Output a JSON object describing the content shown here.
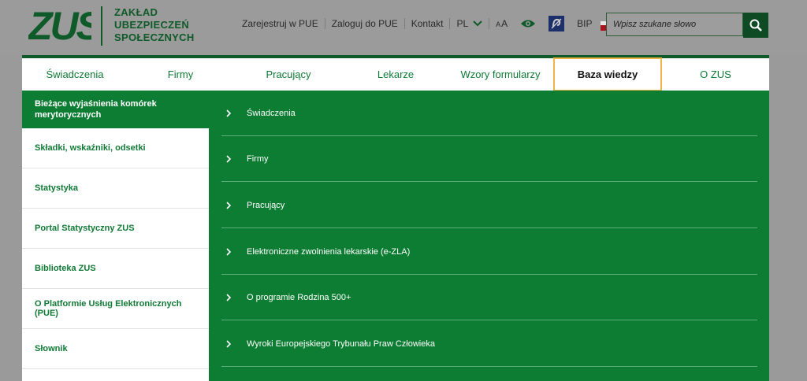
{
  "logo": {
    "line1": "ZAKŁAD",
    "line2": "UBEZPIECZEŃ",
    "line3": "SPOŁECZNYCH"
  },
  "toplinks": {
    "register": "Zarejestruj w PUE",
    "login": "Zaloguj do PUE",
    "contact": "Kontakt",
    "lang": "PL",
    "font_small": "A",
    "font_big": "A",
    "bip": "BIP"
  },
  "search": {
    "placeholder": "Wpisz szukane słowo"
  },
  "nav": {
    "items": [
      {
        "label": "Świadczenia"
      },
      {
        "label": "Firmy"
      },
      {
        "label": "Pracujący"
      },
      {
        "label": "Lekarze"
      },
      {
        "label": "Wzory formularzy"
      },
      {
        "label": "Baza wiedzy"
      },
      {
        "label": "O ZUS"
      }
    ]
  },
  "side": {
    "items": [
      {
        "label": "Bieżące wyjaśnienia komórek merytorycznych"
      },
      {
        "label": "Składki, wskaźniki, odsetki"
      },
      {
        "label": "Statystyka"
      },
      {
        "label": "Portal Statystyczny ZUS"
      },
      {
        "label": "Biblioteka ZUS"
      },
      {
        "label": "O Platformie Usług Elektronicznych (PUE)"
      },
      {
        "label": "Słownik"
      }
    ]
  },
  "panel": {
    "items": [
      {
        "label": "Świadczenia"
      },
      {
        "label": "Firmy"
      },
      {
        "label": "Pracujący"
      },
      {
        "label": "Elektroniczne zwolnienia lekarskie (e-ZLA)"
      },
      {
        "label": "O programie Rodzina 500+"
      },
      {
        "label": "Wyroki Europejskiego Trybunału Praw Człowieka"
      }
    ]
  },
  "colors": {
    "brand_green": "#0e7d34",
    "dark_green": "#0e5a28",
    "highlight": "#f0b54a"
  }
}
